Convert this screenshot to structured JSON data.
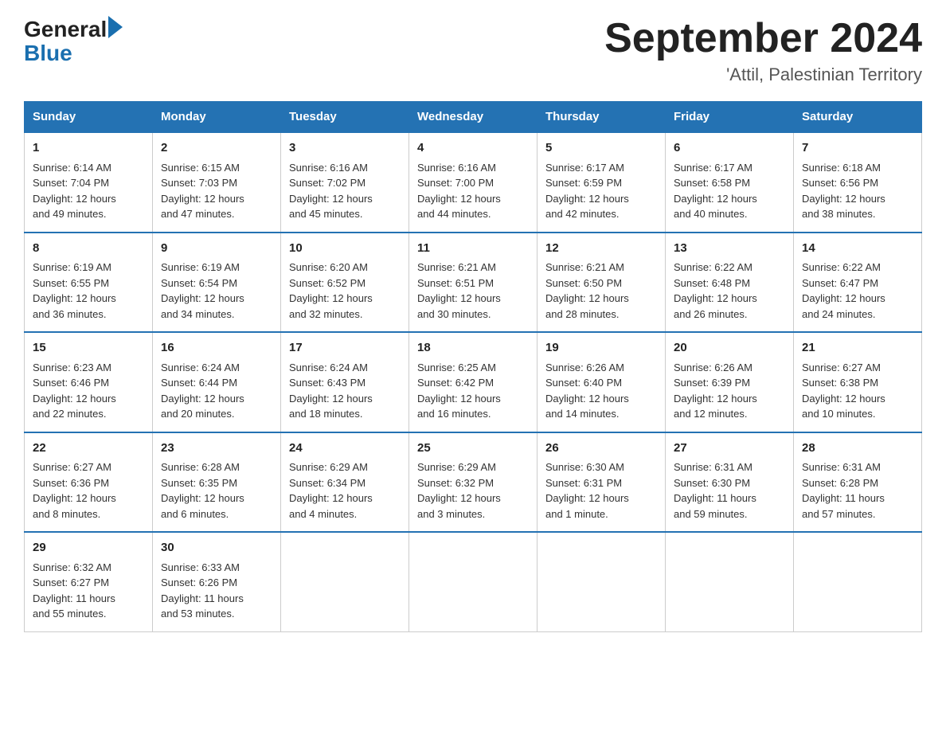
{
  "header": {
    "logo_general": "General",
    "logo_blue": "Blue",
    "month_title": "September 2024",
    "subtitle": "'Attil, Palestinian Territory"
  },
  "days_of_week": [
    "Sunday",
    "Monday",
    "Tuesday",
    "Wednesday",
    "Thursday",
    "Friday",
    "Saturday"
  ],
  "weeks": [
    [
      {
        "day": "1",
        "sunrise": "6:14 AM",
        "sunset": "7:04 PM",
        "daylight": "12 hours and 49 minutes."
      },
      {
        "day": "2",
        "sunrise": "6:15 AM",
        "sunset": "7:03 PM",
        "daylight": "12 hours and 47 minutes."
      },
      {
        "day": "3",
        "sunrise": "6:16 AM",
        "sunset": "7:02 PM",
        "daylight": "12 hours and 45 minutes."
      },
      {
        "day": "4",
        "sunrise": "6:16 AM",
        "sunset": "7:00 PM",
        "daylight": "12 hours and 44 minutes."
      },
      {
        "day": "5",
        "sunrise": "6:17 AM",
        "sunset": "6:59 PM",
        "daylight": "12 hours and 42 minutes."
      },
      {
        "day": "6",
        "sunrise": "6:17 AM",
        "sunset": "6:58 PM",
        "daylight": "12 hours and 40 minutes."
      },
      {
        "day": "7",
        "sunrise": "6:18 AM",
        "sunset": "6:56 PM",
        "daylight": "12 hours and 38 minutes."
      }
    ],
    [
      {
        "day": "8",
        "sunrise": "6:19 AM",
        "sunset": "6:55 PM",
        "daylight": "12 hours and 36 minutes."
      },
      {
        "day": "9",
        "sunrise": "6:19 AM",
        "sunset": "6:54 PM",
        "daylight": "12 hours and 34 minutes."
      },
      {
        "day": "10",
        "sunrise": "6:20 AM",
        "sunset": "6:52 PM",
        "daylight": "12 hours and 32 minutes."
      },
      {
        "day": "11",
        "sunrise": "6:21 AM",
        "sunset": "6:51 PM",
        "daylight": "12 hours and 30 minutes."
      },
      {
        "day": "12",
        "sunrise": "6:21 AM",
        "sunset": "6:50 PM",
        "daylight": "12 hours and 28 minutes."
      },
      {
        "day": "13",
        "sunrise": "6:22 AM",
        "sunset": "6:48 PM",
        "daylight": "12 hours and 26 minutes."
      },
      {
        "day": "14",
        "sunrise": "6:22 AM",
        "sunset": "6:47 PM",
        "daylight": "12 hours and 24 minutes."
      }
    ],
    [
      {
        "day": "15",
        "sunrise": "6:23 AM",
        "sunset": "6:46 PM",
        "daylight": "12 hours and 22 minutes."
      },
      {
        "day": "16",
        "sunrise": "6:24 AM",
        "sunset": "6:44 PM",
        "daylight": "12 hours and 20 minutes."
      },
      {
        "day": "17",
        "sunrise": "6:24 AM",
        "sunset": "6:43 PM",
        "daylight": "12 hours and 18 minutes."
      },
      {
        "day": "18",
        "sunrise": "6:25 AM",
        "sunset": "6:42 PM",
        "daylight": "12 hours and 16 minutes."
      },
      {
        "day": "19",
        "sunrise": "6:26 AM",
        "sunset": "6:40 PM",
        "daylight": "12 hours and 14 minutes."
      },
      {
        "day": "20",
        "sunrise": "6:26 AM",
        "sunset": "6:39 PM",
        "daylight": "12 hours and 12 minutes."
      },
      {
        "day": "21",
        "sunrise": "6:27 AM",
        "sunset": "6:38 PM",
        "daylight": "12 hours and 10 minutes."
      }
    ],
    [
      {
        "day": "22",
        "sunrise": "6:27 AM",
        "sunset": "6:36 PM",
        "daylight": "12 hours and 8 minutes."
      },
      {
        "day": "23",
        "sunrise": "6:28 AM",
        "sunset": "6:35 PM",
        "daylight": "12 hours and 6 minutes."
      },
      {
        "day": "24",
        "sunrise": "6:29 AM",
        "sunset": "6:34 PM",
        "daylight": "12 hours and 4 minutes."
      },
      {
        "day": "25",
        "sunrise": "6:29 AM",
        "sunset": "6:32 PM",
        "daylight": "12 hours and 3 minutes."
      },
      {
        "day": "26",
        "sunrise": "6:30 AM",
        "sunset": "6:31 PM",
        "daylight": "12 hours and 1 minute."
      },
      {
        "day": "27",
        "sunrise": "6:31 AM",
        "sunset": "6:30 PM",
        "daylight": "11 hours and 59 minutes."
      },
      {
        "day": "28",
        "sunrise": "6:31 AM",
        "sunset": "6:28 PM",
        "daylight": "11 hours and 57 minutes."
      }
    ],
    [
      {
        "day": "29",
        "sunrise": "6:32 AM",
        "sunset": "6:27 PM",
        "daylight": "11 hours and 55 minutes."
      },
      {
        "day": "30",
        "sunrise": "6:33 AM",
        "sunset": "6:26 PM",
        "daylight": "11 hours and 53 minutes."
      },
      null,
      null,
      null,
      null,
      null
    ]
  ],
  "labels": {
    "sunrise": "Sunrise: ",
    "sunset": "Sunset: ",
    "daylight": "Daylight: "
  }
}
